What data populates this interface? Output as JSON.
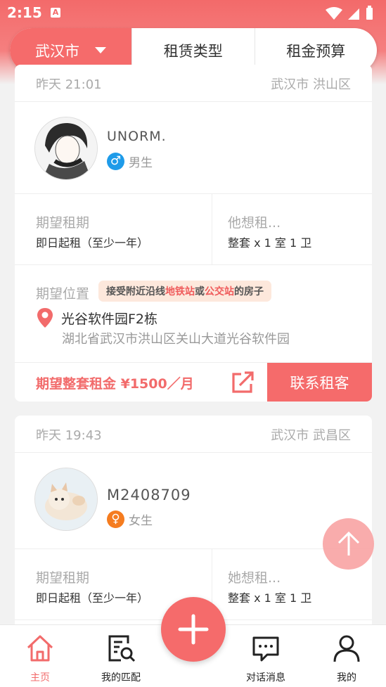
{
  "status_bar": {
    "time": "2:15",
    "a_badge": "A"
  },
  "filters": {
    "city": "武汉市",
    "type": "租赁类型",
    "budget": "租金预算"
  },
  "cards": [
    {
      "time": "昨天 21:01",
      "location": "武汉市 洪山区",
      "username": "UNORM.",
      "gender_symbol": "♂",
      "gender": "男生",
      "lease_label": "期望租期",
      "lease_value": "即日起租（至少一年）",
      "want_label": "他想租...",
      "want_value": "整套 x 1 室 1 卫",
      "position_label": "期望位置",
      "tag_parts": [
        "接受附近沿线",
        "地铁站",
        "或",
        "公交站",
        "的房子"
      ],
      "place": "光谷软件园F2栋",
      "address": "湖北省武汉市洪山区关山大道光谷软件园",
      "budget": "期望整套租金 ¥1500／月",
      "contact": "联系租客"
    },
    {
      "time": "昨天 19:43",
      "location": "武汉市 武昌区",
      "username": "M2408709",
      "gender_symbol": "♀",
      "gender": "女生",
      "lease_label": "期望租期",
      "lease_value": "即日起租（至少一年）",
      "want_label": "她想租...",
      "want_value": "整套 x 1 室 1 卫"
    }
  ],
  "nav": {
    "home": "主页",
    "matches": "我的匹配",
    "messages": "对话消息",
    "mine": "我的"
  },
  "colors": {
    "accent": "#f56b6b",
    "male": "#1e9be9",
    "female": "#f57c1f"
  }
}
